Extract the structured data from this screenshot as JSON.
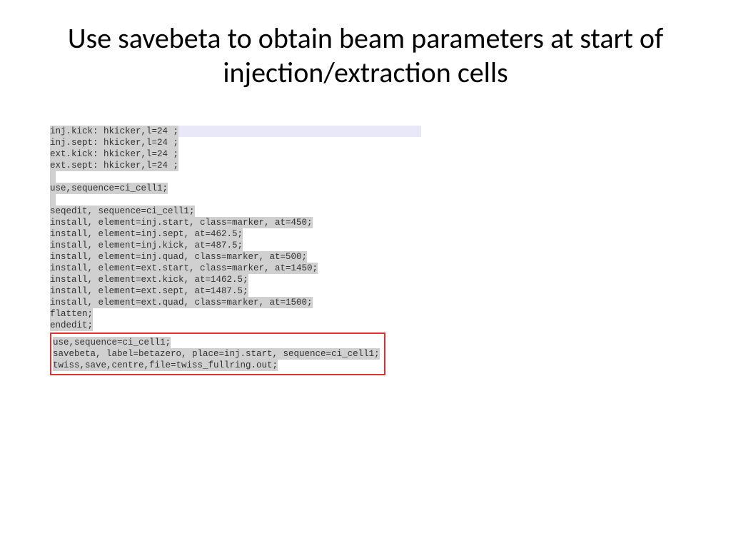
{
  "title": "Use savebeta to obtain beam parameters at start of injection/extraction cells",
  "code": {
    "block1": [
      "inj.kick: hkicker,l=24 ;",
      "inj.sept: hkicker,l=24 ;",
      "ext.kick: hkicker,l=24 ;",
      "ext.sept: hkicker,l=24 ;"
    ],
    "block2": [
      "use,sequence=ci_cell1;"
    ],
    "block3": [
      "seqedit, sequence=ci_cell1;",
      "install, element=inj.start, class=marker, at=450;",
      "install, element=inj.sept, at=462.5;",
      "install, element=inj.kick, at=487.5;",
      "install, element=inj.quad, class=marker, at=500;",
      "install, element=ext.start, class=marker, at=1450;",
      "install, element=ext.kick, at=1462.5;",
      "install, element=ext.sept, at=1487.5;",
      "install, element=ext.quad, class=marker, at=1500;",
      "flatten;",
      "endedit;"
    ],
    "highlighted": [
      "use,sequence=ci_cell1;",
      "savebeta, label=betazero, place=inj.start, sequence=ci_cell1;",
      "twiss,save,centre,file=twiss_fullring.out;"
    ]
  }
}
